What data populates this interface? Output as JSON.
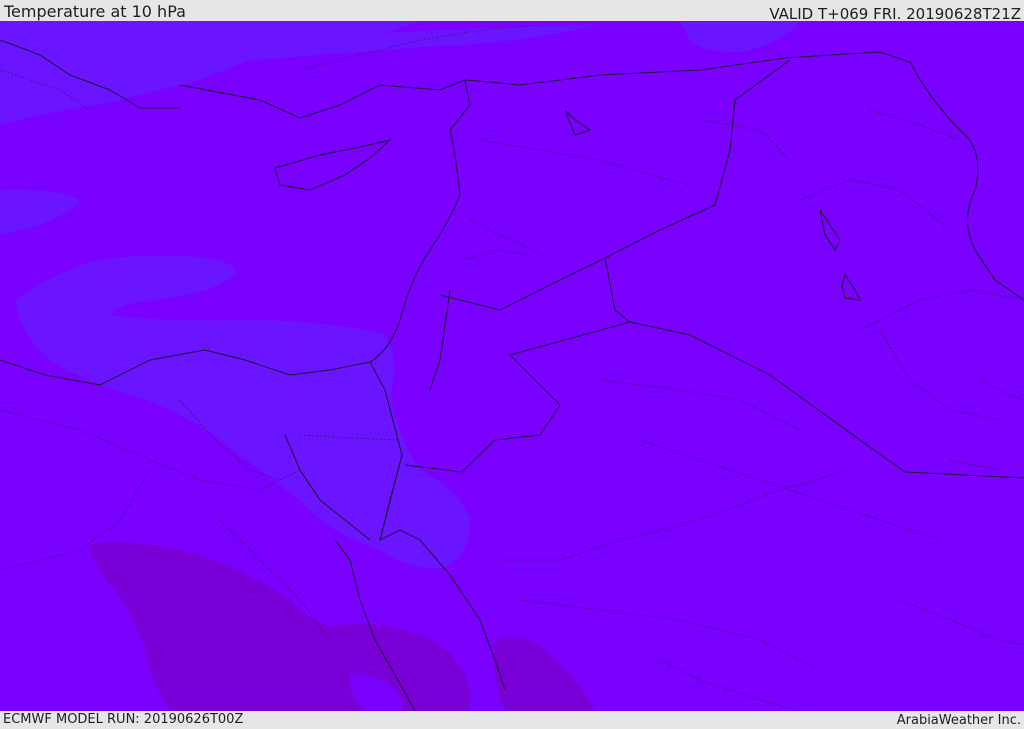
{
  "header": {
    "title": "Temperature at 10 hPa",
    "valid": "VALID T+069 FRI. 20190628T21Z"
  },
  "footer": {
    "model_run": "ECMWF MODEL RUN: 20190626T00Z",
    "credit": "ArabiaWeather Inc."
  },
  "map": {
    "field": "temperature",
    "level": "10 hPa",
    "colors": {
      "background_field": "#7a00ff",
      "warmer_band": "#6a14ff",
      "colder_band": "#7a00d8",
      "borders": "#1a1a2e",
      "frame": "#e6e6e6"
    }
  }
}
